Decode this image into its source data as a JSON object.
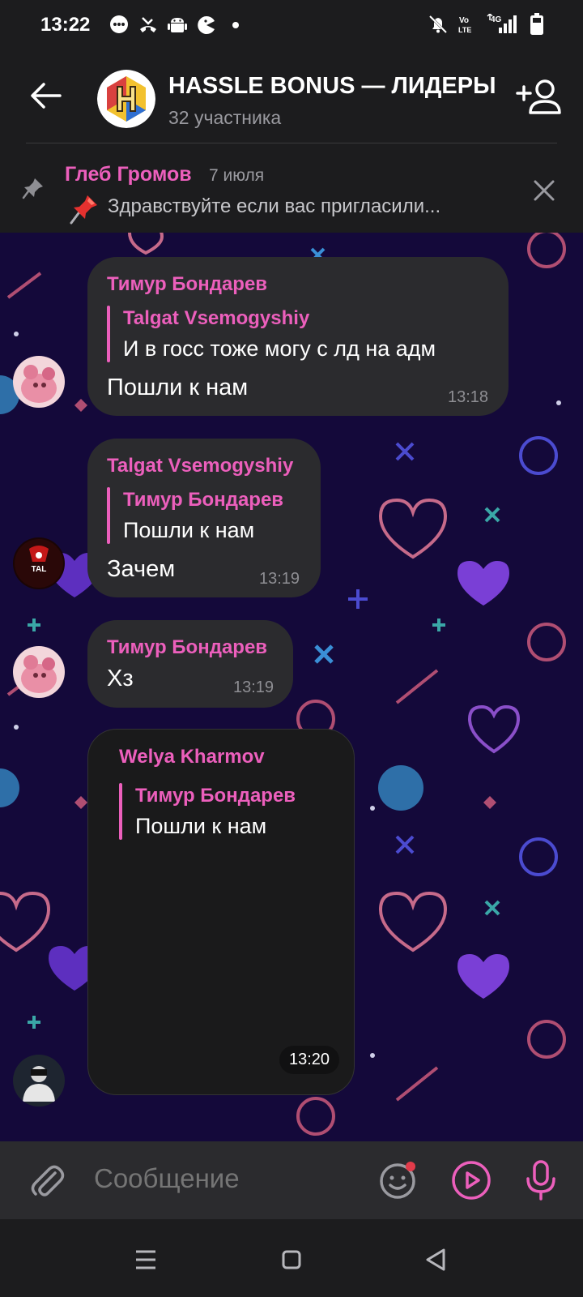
{
  "status_bar": {
    "time": "13:22",
    "left_icons": [
      "messages-icon",
      "missed-call-icon",
      "android-icon",
      "pacman-icon",
      "dot-icon"
    ],
    "right_icons": [
      "bell-mute-icon",
      "volte-icon",
      "4g-signal-icon",
      "battery-icon"
    ],
    "network_label": "4G"
  },
  "header": {
    "title": "HASSLE BONUS — ЛИДЕРЫ",
    "subtitle": "32 участника"
  },
  "pinned": {
    "author": "Глеб Громов",
    "date": "7 июля",
    "text": "Здравствуйте если вас пригласили..."
  },
  "messages": [
    {
      "sender": "Тимур Бондарев",
      "quote_author": "Talgat Vsemogyshiy",
      "quote_text": "И в госс тоже могу с лд на адм",
      "text": "Пошли к нам",
      "time": "13:18"
    },
    {
      "sender": "Talgat Vsemogyshiy",
      "quote_author": "Тимур Бондарев",
      "quote_text": "Пошли к нам",
      "text": "Зачем",
      "time": "13:19"
    },
    {
      "sender": "Тимур Бондарев",
      "text": "Хз",
      "time": "13:19"
    },
    {
      "sender": "Welya Kharmov",
      "quote_author": "Тимур Бондарев",
      "quote_text": "Пошли к нам",
      "time": "13:20"
    }
  ],
  "composer": {
    "placeholder": "Сообщение"
  },
  "colors": {
    "accent": "#ec5fbc",
    "bubble": "#2b2b2e",
    "chat_bg": "#14093a"
  }
}
